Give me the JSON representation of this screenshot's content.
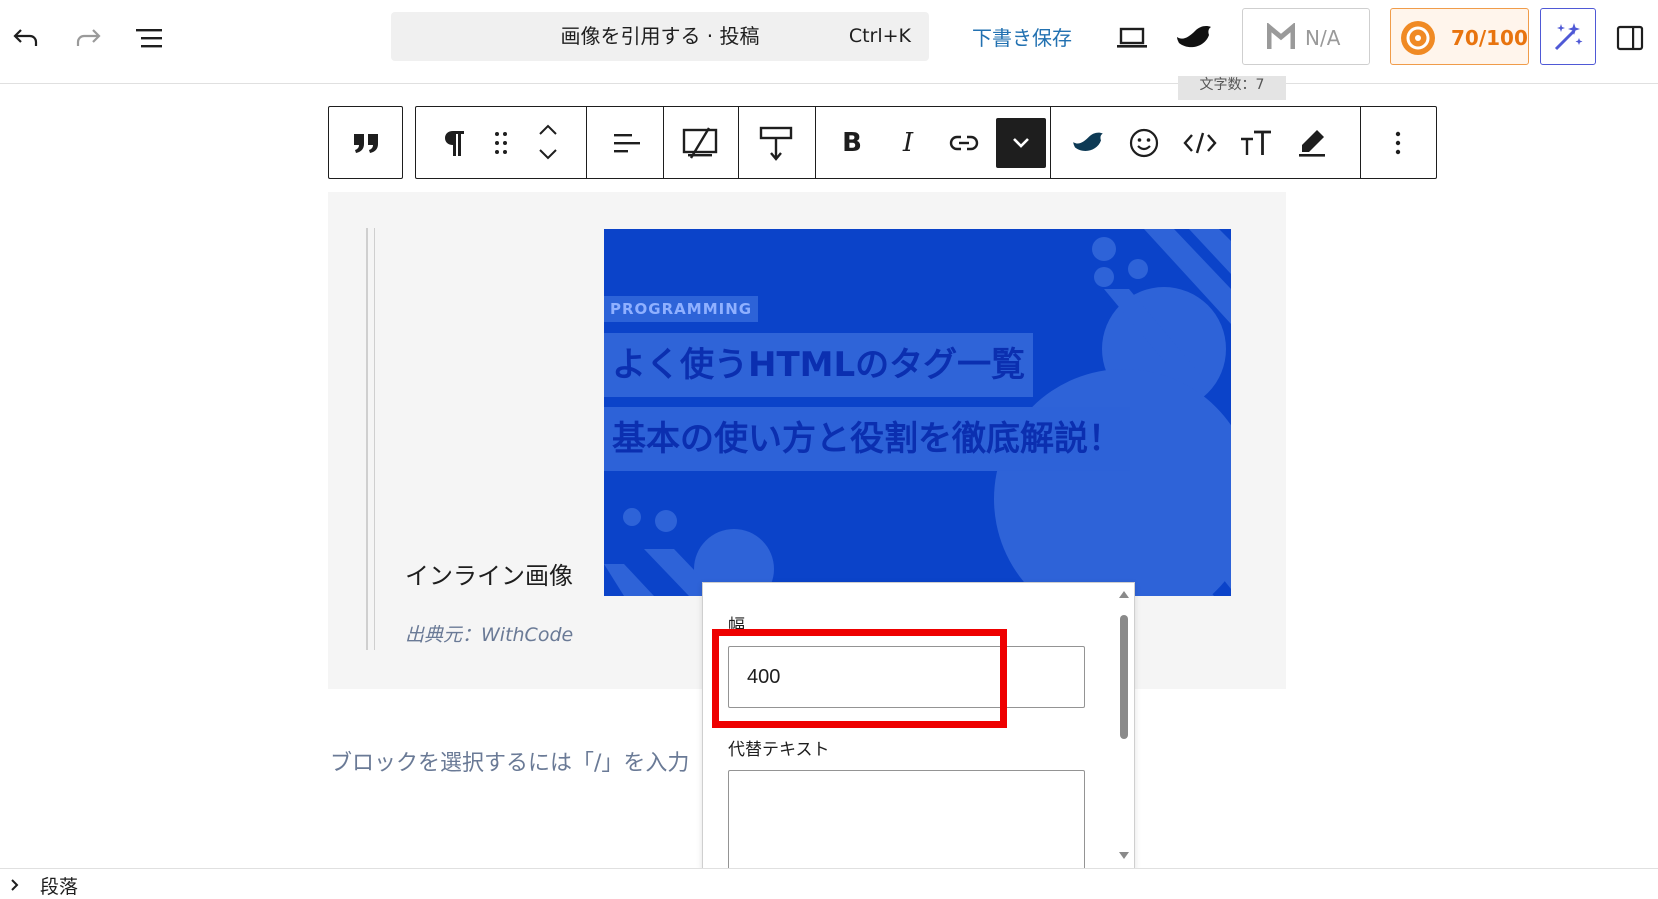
{
  "topbar": {
    "undo_icon": "undo-icon",
    "redo_icon": "redo-icon",
    "list_view_icon": "list-view-icon",
    "command_title": "画像を引用する · 投稿",
    "command_shortcut": "Ctrl+K",
    "save_draft": "下書き保存",
    "preview_icon": "laptop-icon",
    "brand_icon": "swallow-icon",
    "na_label": "N/A",
    "score_label": "70/100",
    "ai_icon": "magic-wand-icon",
    "settings_icon": "sidebar-toggle-icon",
    "word_count": "文字数：7",
    "colors": {
      "link": "#2271b1",
      "score": "#e8740f",
      "ai": "#4f59d6"
    }
  },
  "toolbar": {
    "items": [
      "quote-icon",
      "paragraph-icon",
      "drag-handle-icon",
      "move-up-down-icon",
      "align-left-icon",
      "image-text-icon",
      "height-icon",
      "bold",
      "italic",
      "link-icon",
      "more-chevron-icon",
      "swallow-icon",
      "emoji-icon",
      "code-icon",
      "text-size-icon",
      "highlighter-icon",
      "options-icon"
    ],
    "bold_label": "B",
    "italic_label": "I",
    "text_size_label": "TT"
  },
  "content": {
    "inline_image_label": "インライン画像",
    "citation": "出典元：WithCode",
    "image": {
      "tag": "PROGRAMMING",
      "line1": "よく使うHTMLのタグ一覧",
      "line2": "基本の使い方と役割を徹底解説！",
      "bg_color": "#0b43c9"
    },
    "placeholder": "ブロックを選択するには「/」を入力"
  },
  "popover": {
    "width_label": "幅",
    "width_value": "400",
    "alt_label": "代替テキスト",
    "alt_value": ""
  },
  "footer": {
    "breadcrumb": "段落"
  }
}
